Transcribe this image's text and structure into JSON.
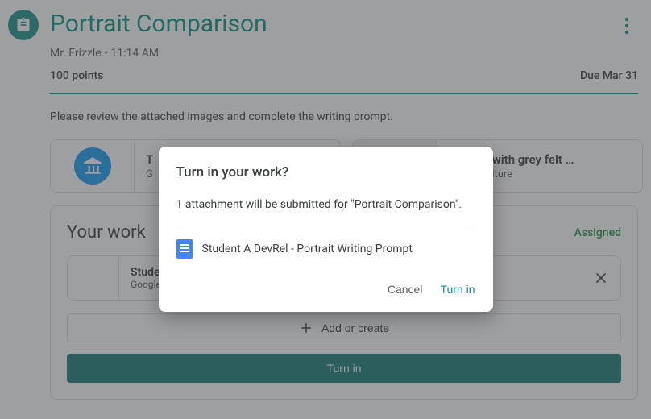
{
  "header": {
    "title": "Portrait Comparison",
    "teacher": "Mr. Frizzle",
    "time": "11:14 AM",
    "subtitle": "Mr. Frizzle • 11:14 AM",
    "points": "100 points",
    "due": "Due Mar 31"
  },
  "description": "Please review the attached images and complete the writing prompt.",
  "attachments": [
    {
      "title": "T",
      "source": "G"
    },
    {
      "title": "Portrait with grey felt …",
      "source": "Arts & Culture"
    }
  ],
  "work": {
    "heading": "Your work",
    "status": "Assigned",
    "file_title": "Studer",
    "file_source": "Google",
    "add_label": "Add or create",
    "turn_in_label": "Turn in"
  },
  "modal": {
    "title": "Turn in your work?",
    "body": "1 attachment will be submitted for \"Portrait Comparison\".",
    "file_name": "Student A DevRel - Portrait Writing Prompt",
    "cancel_label": "Cancel",
    "submit_label": "Turn in"
  }
}
